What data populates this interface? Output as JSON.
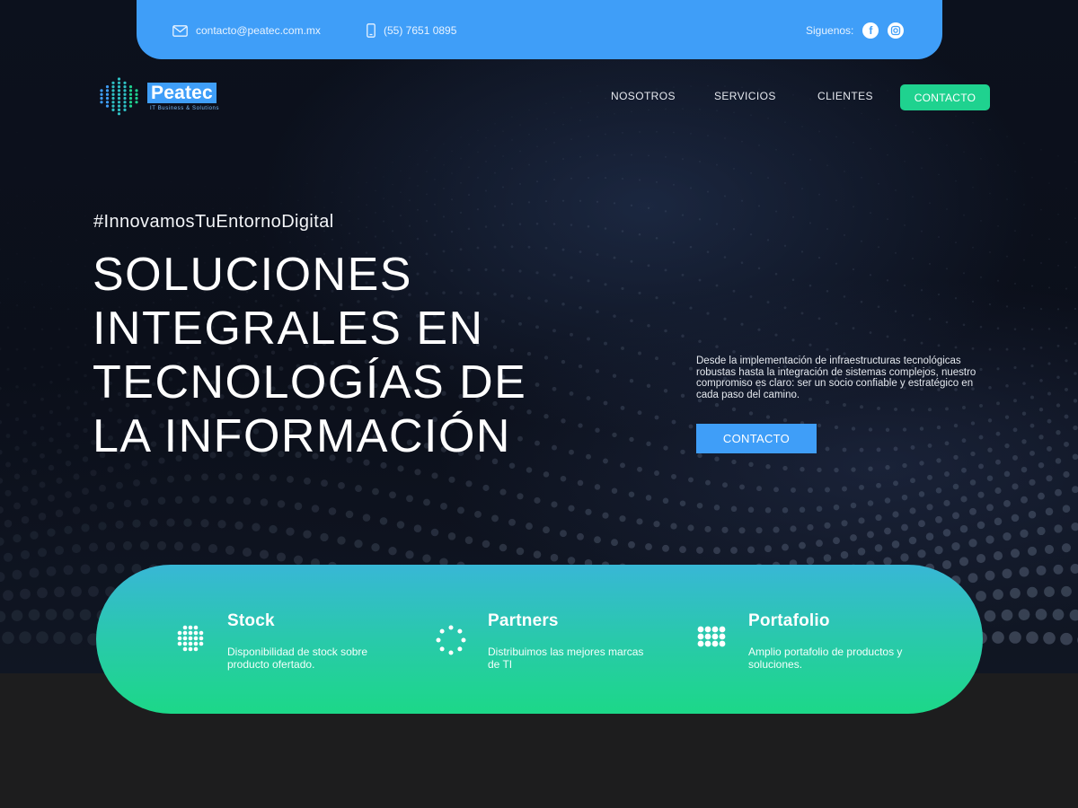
{
  "topbar": {
    "email": "contacto@peatec.com.mx",
    "phone": "(55) 7651 0895",
    "social_label": "Siguenos:",
    "social_icons": [
      "facebook-icon",
      "instagram-icon"
    ]
  },
  "brand": {
    "name": "Peatec",
    "tagline": "IT Business & Solutions"
  },
  "nav": {
    "items": [
      "NOSOTROS",
      "SERVICIOS",
      "CLIENTES"
    ],
    "cta": "CONTACTO"
  },
  "hero": {
    "hashtag": "#InnovamosTuEntornoDigital",
    "headline_lines": [
      "SOLUCIONES",
      "INTEGRALES EN",
      "TECNOLOGÍAS DE",
      "LA INFORMACIÓN"
    ],
    "description": "Desde la implementación de infraestructuras tecnológicas robustas hasta la integración de sistemas complejos, nuestro compromiso es claro: ser un socio confiable y estratégico en cada paso del camino.",
    "cta": "CONTACTO"
  },
  "features": [
    {
      "title": "Stock",
      "text": "Disponibilidad de stock sobre producto ofertado.",
      "icon": "dot-grid-icon"
    },
    {
      "title": "Partners",
      "text": "Distribuimos las mejores marcas de TI",
      "icon": "dot-circle-icon"
    },
    {
      "title": "Portafolio",
      "text": "Amplio portafolio de productos y soluciones.",
      "icon": "dot-square-icon"
    }
  ],
  "colors": {
    "accent_blue": "#3f9ef8",
    "accent_green": "#1fd28f",
    "hero_bg": "#0b0f1a",
    "footer_bg": "#1d1d1e"
  }
}
